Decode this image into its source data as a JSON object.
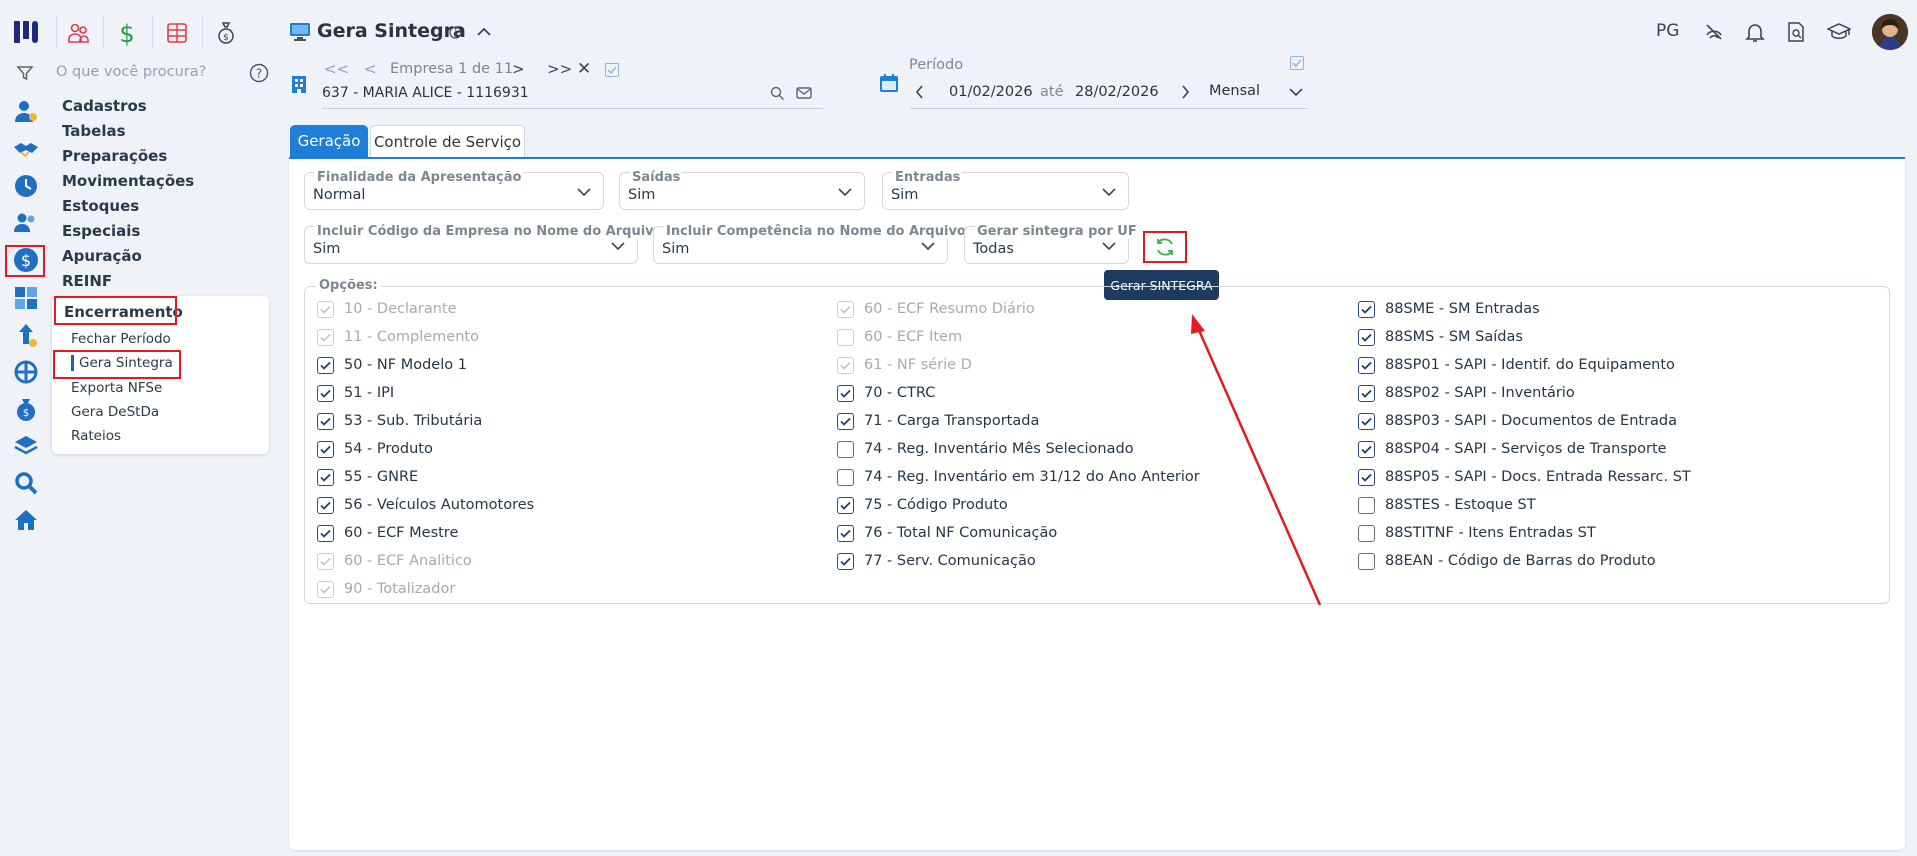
{
  "header": {
    "page_title": "Gera Sintegra",
    "user_initials": "PG"
  },
  "sidebar": {
    "search_placeholder": "O que você procura?",
    "menu": [
      "Cadastros",
      "Tabelas",
      "Preparações",
      "Movimentações",
      "Estoques",
      "Especiais",
      "Apuração",
      "REINF"
    ],
    "encerramento_label": "Encerramento",
    "submenu": [
      "Fechar Período",
      "Gera Sintegra",
      "Exporta NFSe",
      "Gera DeStDa",
      "Rateios"
    ]
  },
  "company": {
    "pager_label": "Empresa 1 de 11",
    "name": "637 - MARIA ALICE - 1116931"
  },
  "period": {
    "label": "Período",
    "start": "01/02/2026",
    "between": "até",
    "end": "28/02/2026",
    "frequency": "Mensal"
  },
  "tabs": [
    {
      "label": "Geração",
      "active": true
    },
    {
      "label": "Controle de Serviço",
      "active": false
    }
  ],
  "form": {
    "finalidade": {
      "label": "Finalidade da Apresentação",
      "value": "Normal"
    },
    "saidas": {
      "label": "Saídas",
      "value": "Sim"
    },
    "entradas": {
      "label": "Entradas",
      "value": "Sim"
    },
    "codigo_empresa": {
      "label": "Incluir Código da Empresa no Nome do Arquivo",
      "value": "Sim"
    },
    "competencia": {
      "label": "Incluir Competência no Nome do Arquivo",
      "value": "Sim"
    },
    "por_uf": {
      "label": "Gerar sintegra por UF",
      "value": "Todas"
    }
  },
  "generate_tooltip": "Gerar SINTEGRA",
  "options_label": "Opções:",
  "options": {
    "col1": [
      {
        "label": "10 - Declarante",
        "checked": true,
        "disabled": true
      },
      {
        "label": "11 - Complemento",
        "checked": true,
        "disabled": true
      },
      {
        "label": "50 - NF Modelo 1",
        "checked": true,
        "disabled": false
      },
      {
        "label": "51 - IPI",
        "checked": true,
        "disabled": false
      },
      {
        "label": "53 - Sub. Tributária",
        "checked": true,
        "disabled": false
      },
      {
        "label": "54 - Produto",
        "checked": true,
        "disabled": false
      },
      {
        "label": "55 - GNRE",
        "checked": true,
        "disabled": false
      },
      {
        "label": "56 - Veículos Automotores",
        "checked": true,
        "disabled": false
      },
      {
        "label": "60 - ECF Mestre",
        "checked": true,
        "disabled": false
      },
      {
        "label": "60 - ECF Analitico",
        "checked": true,
        "disabled": true
      },
      {
        "label": "90 - Totalizador",
        "checked": true,
        "disabled": true
      }
    ],
    "col2": [
      {
        "label": "60 - ECF Resumo Diário",
        "checked": true,
        "disabled": true
      },
      {
        "label": "60 - ECF Item",
        "checked": false,
        "disabled": true
      },
      {
        "label": "61 - NF série D",
        "checked": true,
        "disabled": true
      },
      {
        "label": "70 - CTRC",
        "checked": true,
        "disabled": false
      },
      {
        "label": "71 - Carga Transportada",
        "checked": true,
        "disabled": false
      },
      {
        "label": "74 - Reg. Inventário Mês Selecionado",
        "checked": false,
        "disabled": false
      },
      {
        "label": "74 - Reg. Inventário em 31/12 do Ano Anterior",
        "checked": false,
        "disabled": false
      },
      {
        "label": "75 - Código Produto",
        "checked": true,
        "disabled": false
      },
      {
        "label": "76 - Total NF Comunicação",
        "checked": true,
        "disabled": false
      },
      {
        "label": "77 - Serv. Comunicação",
        "checked": true,
        "disabled": false
      }
    ],
    "col3": [
      {
        "label": "88SME - SM Entradas",
        "checked": true,
        "disabled": false
      },
      {
        "label": "88SMS - SM Saídas",
        "checked": true,
        "disabled": false
      },
      {
        "label": "88SP01 - SAPI - Identif. do Equipamento",
        "checked": true,
        "disabled": false
      },
      {
        "label": "88SP02 - SAPI - Inventário",
        "checked": true,
        "disabled": false
      },
      {
        "label": "88SP03 - SAPI - Documentos de Entrada",
        "checked": true,
        "disabled": false
      },
      {
        "label": "88SP04 - SAPI - Serviços de Transporte",
        "checked": true,
        "disabled": false
      },
      {
        "label": "88SP05 - SAPI - Docs. Entrada Ressarc. ST",
        "checked": true,
        "disabled": false
      },
      {
        "label": "88STES - Estoque ST",
        "checked": false,
        "disabled": false
      },
      {
        "label": "88STITNF - Itens Entradas ST",
        "checked": false,
        "disabled": false
      },
      {
        "label": "88EAN - Código de Barras do Produto",
        "checked": false,
        "disabled": false
      }
    ]
  },
  "colors": {
    "accent": "#1565c0",
    "annotation": "#e01b24",
    "tooltip_bg": "#1e3a5f",
    "refresh": "#2fb84b"
  }
}
